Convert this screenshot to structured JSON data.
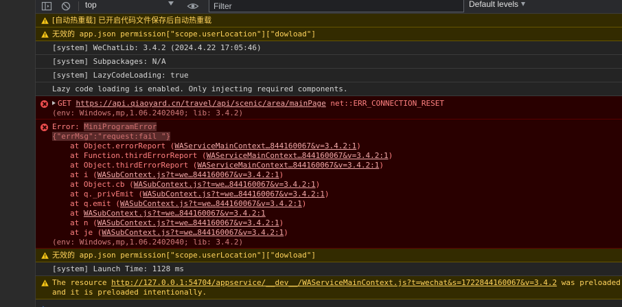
{
  "toolbar": {
    "context": "top",
    "filter_placeholder": "Filter",
    "levels_label": "Default levels"
  },
  "rows": {
    "hot_reload": "[自动热重载] 已开启代码文件保存后自动热重载",
    "perm_warn_1": "无效的 app.json permission[\"scope.userLocation\"][\"dowload\"]",
    "wechatlib": "[system] WeChatLib: 3.4.2 (2024.4.22 17:05:46)",
    "subpackages": "[system] Subpackages: N/A",
    "lazy_code": "[system] LazyCodeLoading: true",
    "lazy_msg": "Lazy code loading is enabled. Only injecting required components.",
    "get_method": "GET",
    "get_url": "https://api.qiaoyard.cn/travel/api/scenic/area/mainPage",
    "get_error": "net::ERR_CONNECTION_RESET",
    "get_env": "(env: Windows,mp,1.06.2402040; lib: 3.4.2)",
    "error_prefix": "Error:",
    "error_redacted_1": "MiniProgramError",
    "error_redacted_2": "{\"errMsg\":\"request:fail \"}",
    "stack": [
      {
        "pre": "at Object.errorReport (",
        "link": "WAServiceMainContext…844160067&v=3.4.2:1",
        "post": ")"
      },
      {
        "pre": "at Function.thirdErrorReport (",
        "link": "WAServiceMainContext…844160067&v=3.4.2:1",
        "post": ")"
      },
      {
        "pre": "at Object.thirdErrorReport (",
        "link": "WAServiceMainContext…844160067&v=3.4.2:1",
        "post": ")"
      },
      {
        "pre": "at i (",
        "link": "WASubContext.js?t=we…844160067&v=3.4.2:1",
        "post": ")"
      },
      {
        "pre": "at Object.cb (",
        "link": "WASubContext.js?t=we…844160067&v=3.4.2:1",
        "post": ")"
      },
      {
        "pre": "at q._privEmit (",
        "link": "WASubContext.js?t=we…844160067&v=3.4.2:1",
        "post": ")"
      },
      {
        "pre": "at q.emit (",
        "link": "WASubContext.js?t=we…844160067&v=3.4.2:1",
        "post": ")"
      },
      {
        "pre": "at ",
        "link": "WASubContext.js?t=we…844160067&v=3.4.2:1",
        "post": ""
      },
      {
        "pre": "at n (",
        "link": "WASubContext.js?t=we…844160067&v=3.4.2:1",
        "post": ")"
      },
      {
        "pre": "at je (",
        "link": "WASubContext.js?t=we…844160067&v=3.4.2:1",
        "post": ")"
      }
    ],
    "error_env": "(env: Windows,mp,1.06.2402040; lib: 3.4.2)",
    "perm_warn_2": "无效的 app.json permission[\"scope.userLocation\"][\"dowload\"]",
    "launch_time": "[system] Launch Time: 1128 ms",
    "preload_pre": "The resource ",
    "preload_url": "http://127.0.0.1:54704/appservice/__dev__/WAServiceMainContext.js?t=wechat&s=1722844160067&v=3.4.2",
    "preload_post": " was preloaded",
    "preload_line2": "and it is preloaded intentionally."
  },
  "prompt": "›",
  "colors": {
    "warn_bg": "#332b00",
    "warn_text": "#ffd35c",
    "error_bg": "#290000",
    "error_text": "#ff8080",
    "prompt_blue": "#4c8df6"
  }
}
